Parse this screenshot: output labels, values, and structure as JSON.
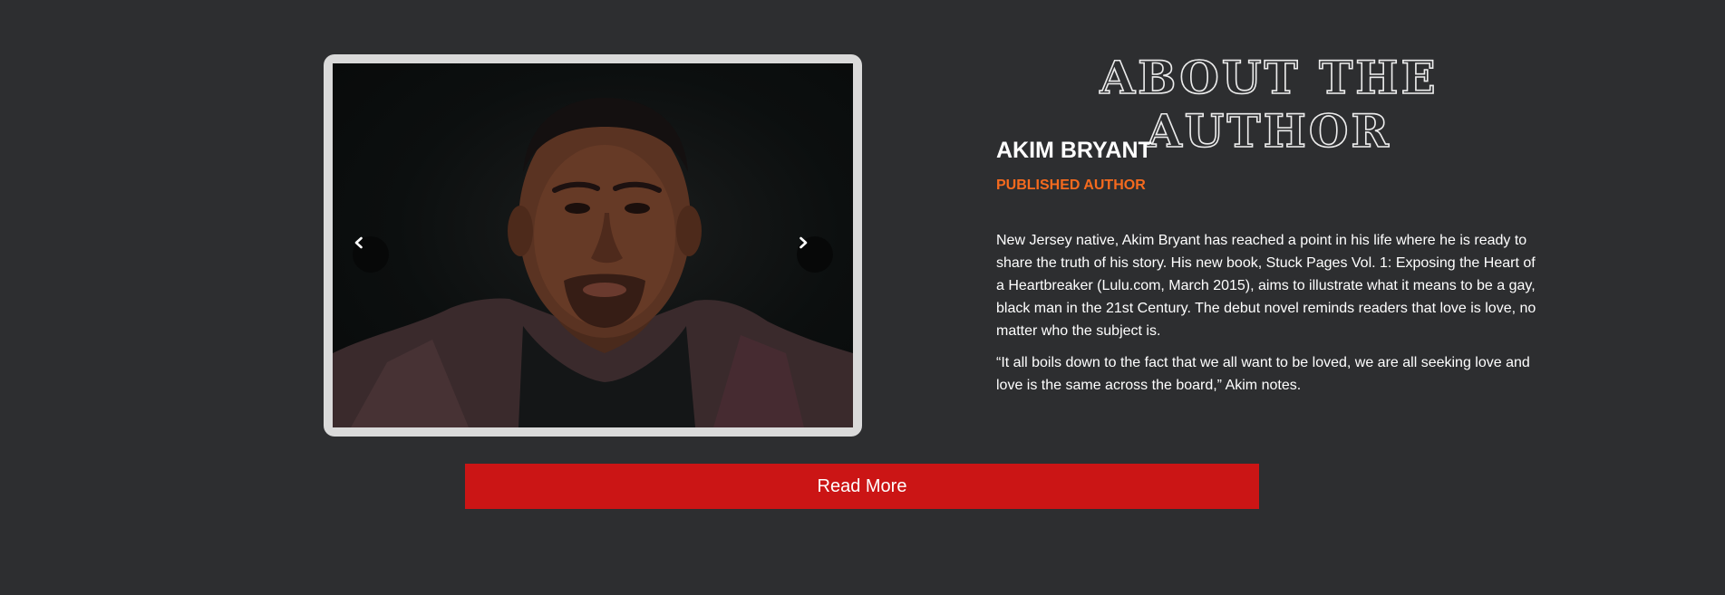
{
  "about": {
    "title": "ABOUT THE AUTHOR",
    "name": "AKIM BRYANT",
    "role": "PUBLISHED AUTHOR",
    "paragraphs": [
      "New Jersey native, Akim Bryant has reached a point in his life where he is ready to share the truth of his story. His new book, Stuck Pages Vol. 1: Exposing the Heart of a Heartbreaker (Lulu.com, March 2015), aims to illustrate what it means to be a gay, black man in the 21st Century. The debut novel reminds readers that love is love, no matter who the subject is.",
      "“It all boils down to the fact that we all want to be loved, we are all seeking love and love is the same across the board,” Akim notes."
    ]
  },
  "slider": {
    "prev_icon": "chevron-left-icon",
    "next_icon": "chevron-right-icon"
  },
  "cta": {
    "read_more_label": "Read More"
  },
  "colors": {
    "background": "#2d2e30",
    "accent_orange": "#f56a1e",
    "button_red": "#cb1515",
    "frame": "#dadada"
  }
}
